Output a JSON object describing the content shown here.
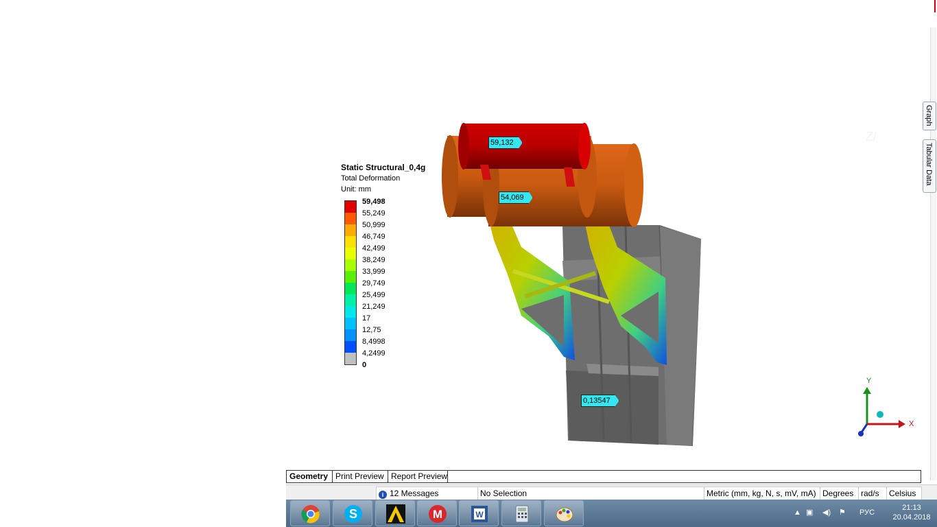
{
  "legend": {
    "title": "Static Structural_0,4g",
    "result": "Total Deformation",
    "unit": "Unit: mm",
    "values": [
      "59,498",
      "55,249",
      "50,999",
      "46,749",
      "42,499",
      "38,249",
      "33,999",
      "29,749",
      "25,499",
      "21,249",
      "17",
      "12,75",
      "8,4998",
      "4,2499",
      "0"
    ],
    "colors": [
      "#e00000",
      "#ff5a00",
      "#ffaa00",
      "#ffe000",
      "#e8ff00",
      "#a8ff00",
      "#58f000",
      "#00e85a",
      "#00f0a8",
      "#00e8e8",
      "#00c0ff",
      "#0090ff",
      "#0050ff",
      "#c0c0c0"
    ]
  },
  "probes": {
    "max_top": "59,132",
    "mid": "54,069",
    "min": "0,13547"
  },
  "triad": {
    "y_label": "Y",
    "x_label": "X"
  },
  "side_tabs": {
    "graph": "Graph",
    "tabular_data": "Tabular Data"
  },
  "bottom_tabs": [
    "Geometry",
    "Print Preview",
    "Report Preview"
  ],
  "status": {
    "messages": "12 Messages",
    "selection": "No Selection",
    "units": "Metric (mm, kg, N, s, mV, mA)",
    "angle": "Degrees",
    "rot_velocity": "rad/s",
    "temperature": "Celsius"
  },
  "taskbar": {
    "apps": [
      "chrome-icon",
      "skype-icon",
      "archicad-icon",
      "mega-icon",
      "word-icon",
      "calculator-icon",
      "paint-icon"
    ],
    "lang": "РУС",
    "time": "21:13",
    "date": "20.04.2018"
  }
}
